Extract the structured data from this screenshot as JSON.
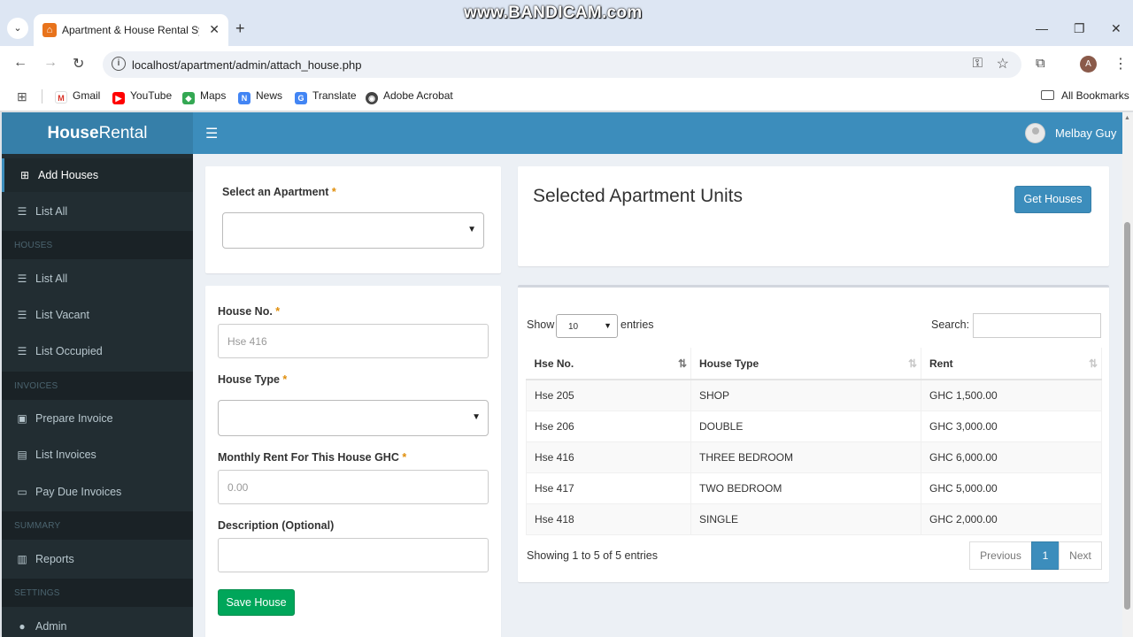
{
  "browser": {
    "tab_title": "Apartment & House Rental Syst",
    "url": "localhost/apartment/admin/attach_house.php",
    "watermark": "www.BANDICAM.com",
    "profile_initial": "A",
    "bookmarks": [
      "Gmail",
      "YouTube",
      "Maps",
      "News",
      "Translate",
      "Adobe Acrobat"
    ],
    "all_bookmarks": "All Bookmarks"
  },
  "app": {
    "logo_bold": "House",
    "logo_rest": "Rental",
    "user_name": "Melbay Guy"
  },
  "sidebar": {
    "items": [
      {
        "label": "Add Houses",
        "icon": "plus-square-icon",
        "active": true
      },
      {
        "label": "List All",
        "icon": "list-icon"
      }
    ],
    "houses_header": "HOUSES",
    "houses_items": [
      {
        "label": "List All",
        "icon": "list-icon"
      },
      {
        "label": "List Vacant",
        "icon": "list-icon"
      },
      {
        "label": "List Occupied",
        "icon": "list-icon"
      }
    ],
    "invoices_header": "INVOICES",
    "invoices_items": [
      {
        "label": "Prepare Invoice",
        "icon": "money-icon"
      },
      {
        "label": "List Invoices",
        "icon": "file-icon"
      },
      {
        "label": "Pay Due Invoices",
        "icon": "credit-card-icon"
      }
    ],
    "summary_header": "SUMMARY",
    "summary_items": [
      {
        "label": "Reports",
        "icon": "bar-chart-icon"
      }
    ],
    "settings_header": "SETTINGS",
    "settings_items": [
      {
        "label": "Admin",
        "icon": "user-icon"
      }
    ]
  },
  "form": {
    "apartment_label": "Select an Apartment",
    "house_no_label": "House No.",
    "house_no_placeholder": "Hse 416",
    "house_type_label": "House Type",
    "rent_label": "Monthly Rent For This House GHC",
    "rent_placeholder": "0.00",
    "description_label": "Description (Optional)",
    "required_mark": "*",
    "save_button": "Save House"
  },
  "units": {
    "title": "Selected Apartment Units",
    "get_button": "Get Houses",
    "show_label": "Show",
    "page_length": "10",
    "entries_label": "entries",
    "search_label": "Search:",
    "columns": [
      "Hse No.",
      "House Type",
      "Rent"
    ],
    "rows": [
      [
        "Hse 205",
        "SHOP",
        "GHC 1,500.00"
      ],
      [
        "Hse 206",
        "DOUBLE",
        "GHC 3,000.00"
      ],
      [
        "Hse 416",
        "THREE BEDROOM",
        "GHC 6,000.00"
      ],
      [
        "Hse 417",
        "TWO BEDROOM",
        "GHC 5,000.00"
      ],
      [
        "Hse 418",
        "SINGLE",
        "GHC 2,000.00"
      ]
    ],
    "info": "Showing 1 to 5 of 5 entries",
    "pager": {
      "previous": "Previous",
      "current": "1",
      "next": "Next"
    }
  },
  "colors": {
    "header": "#3c8dbc",
    "sidebar": "#222d32",
    "save": "#00a65a"
  }
}
